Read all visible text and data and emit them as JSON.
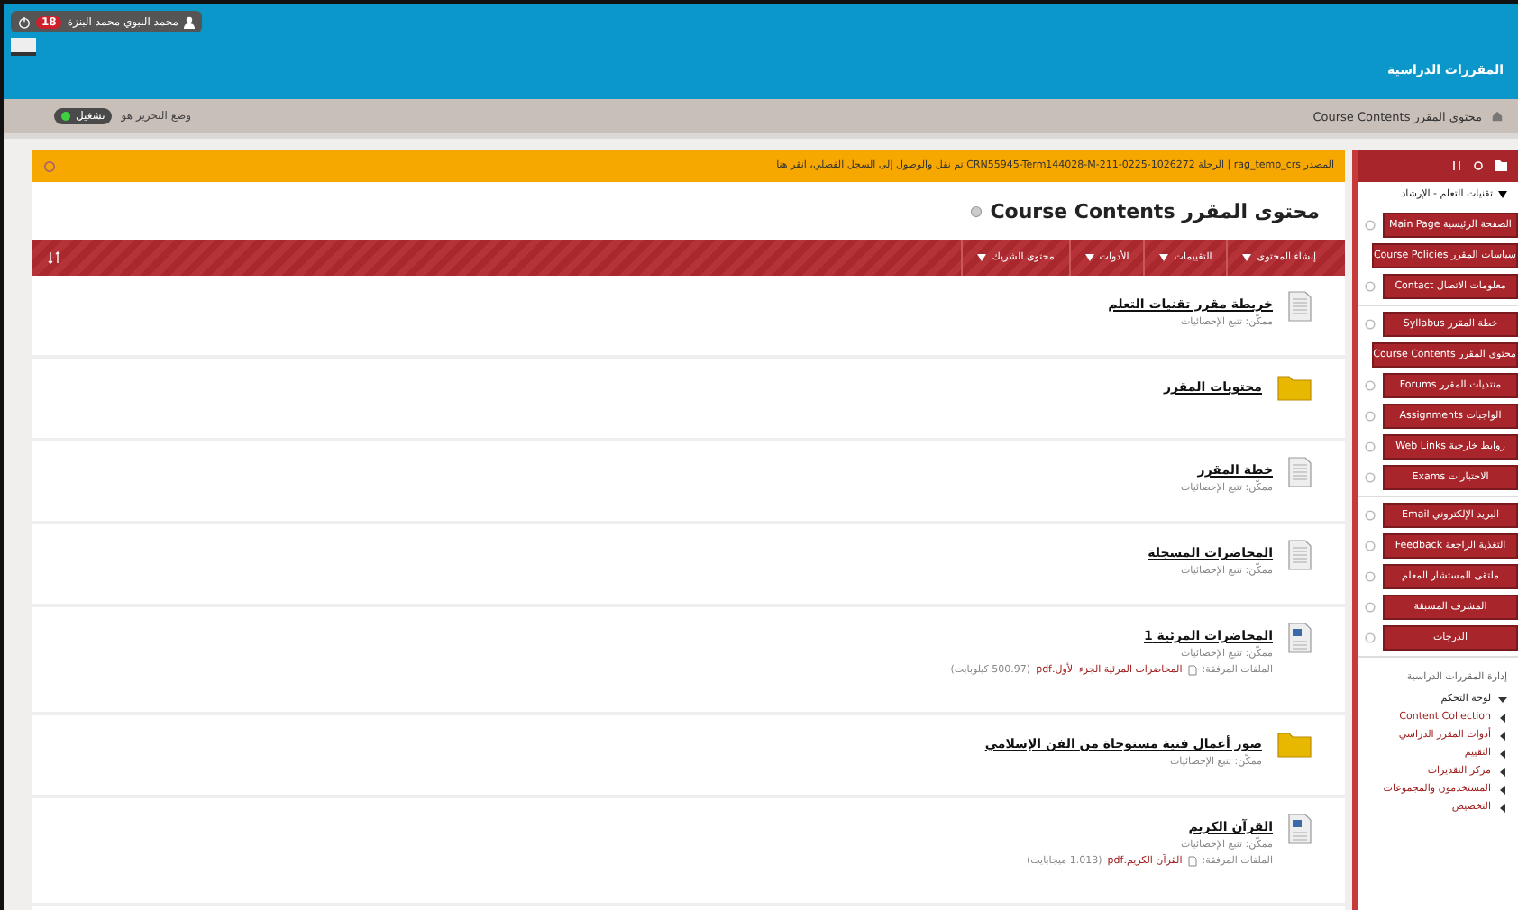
{
  "header": {
    "user_name": "محمد النبوي محمد البنزة",
    "notification_count": "18",
    "site_title": "المقررات الدراسية"
  },
  "breadcrumb": {
    "items": [
      "Course Contents محتوى المقرر"
    ]
  },
  "edit_mode": {
    "label": "وضع التحرير هو",
    "on": true,
    "state_text": "تشغيل"
  },
  "notice": "المصدر rag_temp_crs | الرحلة CRN55945-Term144028-M-211-0225-1026272 تم نقل والوصول إلى السجل الفصلي، انقر هنا",
  "page_title": {
    "arabic": "محتوى المقرر",
    "english": "Course Contents"
  },
  "action_menus": [
    {
      "label": "إنشاء المحتوى"
    },
    {
      "label": "التقييمات"
    },
    {
      "label": "الأدوات"
    },
    {
      "label": "محتوى الشريك"
    }
  ],
  "content_items": [
    {
      "kind": "document",
      "title": "خريطة مقرر تقنيات التعلم",
      "meta": "ممكّن: تتبع الإحصائيات"
    },
    {
      "kind": "folder",
      "title": "محتويات المقرر"
    },
    {
      "kind": "document",
      "title": "خطة المقرر",
      "meta": "ممكّن: تتبع الإحصائيات"
    },
    {
      "kind": "document",
      "title": "المحاضرات المسجلة",
      "meta": "ممكّن: تتبع الإحصائيات"
    },
    {
      "kind": "attachment",
      "title": "المحاضرات المرئية 1",
      "meta": "ممكّن: تتبع الإحصائيات",
      "attachment": {
        "label": "الملفات المرفقة:",
        "file": "المحاضرات المرئية الجزء الأول.pdf",
        "size": "(500.97 كيلوبايت)"
      }
    },
    {
      "kind": "folder",
      "title": "صور أعمال فنية مستوحاة من الفن الإسلامي",
      "meta": "ممكّن: تتبع الإحصائيات"
    },
    {
      "kind": "attachment",
      "title": "القرآن الكريم",
      "meta": "ممكّن: تتبع الإحصائيات",
      "attachment": {
        "label": "الملفات المرفقة:",
        "file": "القرآن الكريم.pdf",
        "size": "(1.013 ميجابايت)"
      }
    }
  ],
  "course_menu": {
    "course_name": "تقنيات التعلم - الإرشاد",
    "sections": [
      [
        "الصفحة الرئيسية Main Page",
        "سياسات المقرر Course Policies",
        "معلومات الاتصال Contact"
      ],
      [
        "خطة المقرر Syllabus",
        "محتوى المقرر Course Contents",
        "منتديات المقرر Forums",
        "الواجبات Assignments",
        "روابط خارجية Web Links",
        "الاختبارات Exams"
      ],
      [
        "البريد الإلكتروني Email",
        "التغذية الراجعة Feedback",
        "ملتقى المستشار المعلم",
        "المشرف المسبقة",
        "الدرجات"
      ]
    ]
  },
  "management": {
    "title": "إدارة المقررات الدراسية",
    "items": [
      {
        "label": "لوحة التحكم",
        "expanded": true
      },
      {
        "label": "Content Collection",
        "expanded": false
      },
      {
        "label": "أدوات المقرر الدراسي",
        "expanded": false
      },
      {
        "label": "التقييم",
        "expanded": false
      },
      {
        "label": "مركز التقديرات",
        "expanded": false
      },
      {
        "label": "المستخدمون والمجموعات",
        "expanded": false
      },
      {
        "label": "التخصيص",
        "expanded": false
      }
    ]
  }
}
